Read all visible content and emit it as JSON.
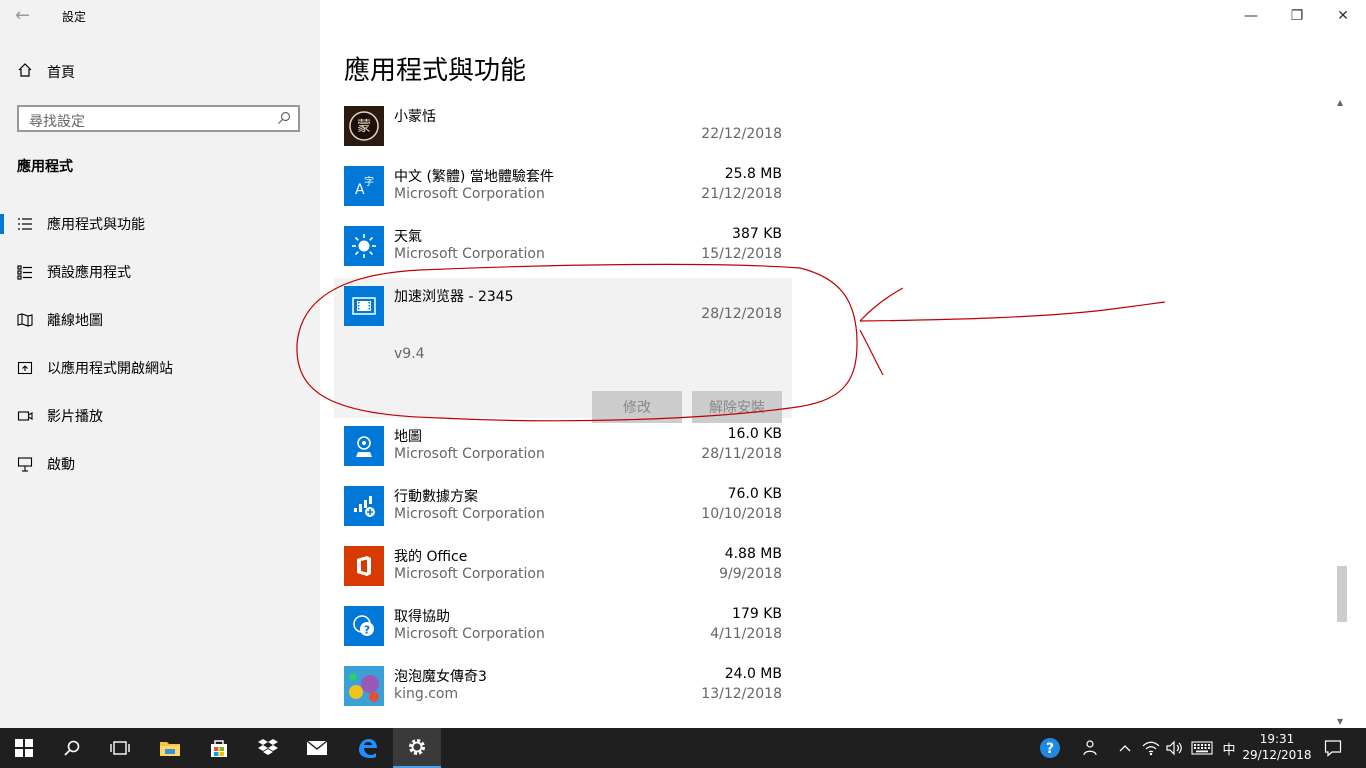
{
  "window": {
    "title": "設定",
    "back_glyph": "←",
    "minimize_glyph": "—",
    "restore_glyph": "❐",
    "close_glyph": "✕"
  },
  "sidebar": {
    "home_label": "首頁",
    "search_placeholder": "尋找設定",
    "section_title": "應用程式",
    "items": [
      {
        "label": "應用程式與功能",
        "icon": "apps-features-icon",
        "active": true
      },
      {
        "label": "預設應用程式",
        "icon": "default-apps-icon",
        "active": false
      },
      {
        "label": "離線地圖",
        "icon": "offline-maps-icon",
        "active": false
      },
      {
        "label": "以應用程式開啟網站",
        "icon": "apps-websites-icon",
        "active": false
      },
      {
        "label": "影片播放",
        "icon": "video-playback-icon",
        "active": false
      },
      {
        "label": "啟動",
        "icon": "startup-icon",
        "active": false
      }
    ]
  },
  "main": {
    "title": "應用程式與功能",
    "apps": [
      {
        "name": "小蒙恬",
        "publisher": "",
        "size": "",
        "date": "22/12/2018",
        "icon": "xiaomengtian-icon",
        "color": "#2b1a12"
      },
      {
        "name": "中文 (繁體) 當地體驗套件",
        "publisher": "Microsoft Corporation",
        "size": "25.8 MB",
        "date": "21/12/2018",
        "icon": "language-pack-icon",
        "color": "#0078d7"
      },
      {
        "name": "天氣",
        "publisher": "Microsoft Corporation",
        "size": "387 KB",
        "date": "15/12/2018",
        "icon": "weather-icon",
        "color": "#0078d7"
      },
      {
        "name": "加速浏览器 - 2345",
        "publisher": "",
        "size": "",
        "date": "28/12/2018",
        "icon": "browser-2345-icon",
        "color": "#0078d7",
        "version": "v9.4",
        "selected": true,
        "modify_label": "修改",
        "uninstall_label": "解除安裝"
      },
      {
        "name": "地圖",
        "publisher": "Microsoft Corporation",
        "size": "16.0 KB",
        "date": "28/11/2018",
        "icon": "maps-icon",
        "color": "#0078d7"
      },
      {
        "name": "行動數據方案",
        "publisher": "Microsoft Corporation",
        "size": "76.0 KB",
        "date": "10/10/2018",
        "icon": "mobile-plans-icon",
        "color": "#0078d7"
      },
      {
        "name": "我的 Office",
        "publisher": "Microsoft Corporation",
        "size": "4.88 MB",
        "date": "9/9/2018",
        "icon": "office-icon",
        "color": "#d83b01"
      },
      {
        "name": "取得協助",
        "publisher": "Microsoft Corporation",
        "size": "179 KB",
        "date": "4/11/2018",
        "icon": "get-help-icon",
        "color": "#0078d7"
      },
      {
        "name": "泡泡魔女傳奇3",
        "publisher": "king.com",
        "size": "24.0 MB",
        "date": "13/12/2018",
        "icon": "bubble-witch-icon",
        "color": "#6a3fa0"
      }
    ]
  },
  "taskbar": {
    "clock_time": "19:31",
    "clock_date": "29/12/2018",
    "ime_label": "中",
    "accent": "#4aa0e6"
  },
  "colors": {
    "accent": "#0078d7",
    "annotation": "#c00000"
  }
}
